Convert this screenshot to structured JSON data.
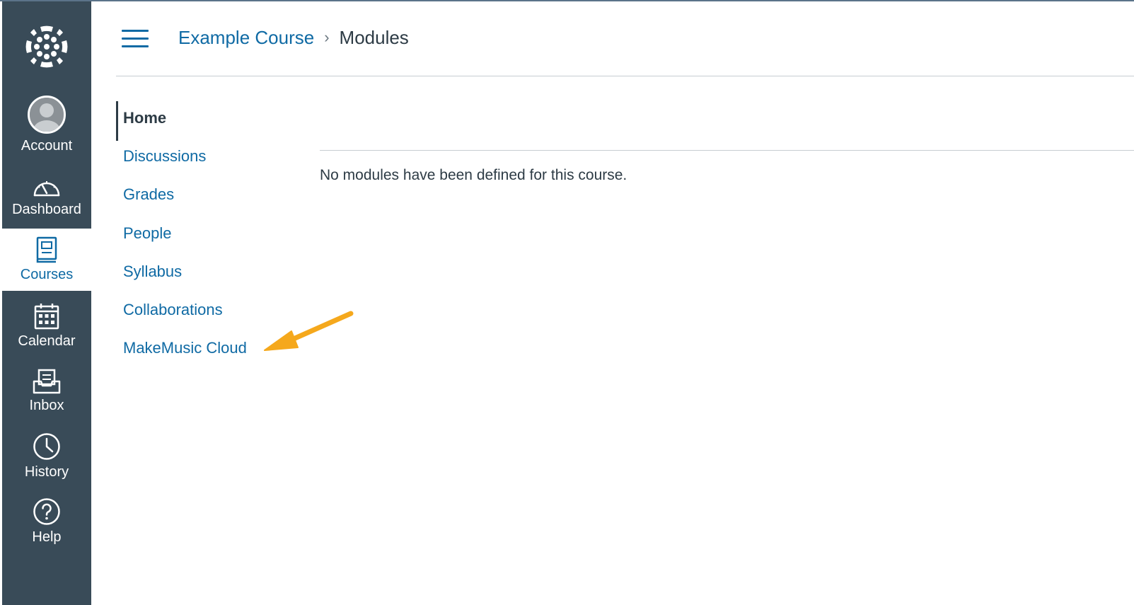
{
  "global_nav": {
    "items": [
      {
        "label": "Account",
        "icon": "avatar-icon"
      },
      {
        "label": "Dashboard",
        "icon": "dashboard-icon"
      },
      {
        "label": "Courses",
        "icon": "courses-icon",
        "active": true
      },
      {
        "label": "Calendar",
        "icon": "calendar-icon"
      },
      {
        "label": "Inbox",
        "icon": "inbox-icon"
      },
      {
        "label": "History",
        "icon": "clock-icon"
      },
      {
        "label": "Help",
        "icon": "help-icon"
      }
    ],
    "background": "#394b58",
    "active_color": "#0f6aa4"
  },
  "header": {
    "course": "Example Course",
    "separator": "›",
    "current": "Modules"
  },
  "course_nav": {
    "items": [
      {
        "label": "Home",
        "active": true
      },
      {
        "label": "Discussions"
      },
      {
        "label": "Grades"
      },
      {
        "label": "People"
      },
      {
        "label": "Syllabus"
      },
      {
        "label": "Collaborations"
      },
      {
        "label": "MakeMusic Cloud"
      }
    ]
  },
  "main": {
    "empty_message": "No modules have been defined for this course."
  },
  "annotation": {
    "arrow_color": "#f5a81c"
  },
  "colors": {
    "link": "#0f6aa4",
    "text": "#2d3b45"
  }
}
